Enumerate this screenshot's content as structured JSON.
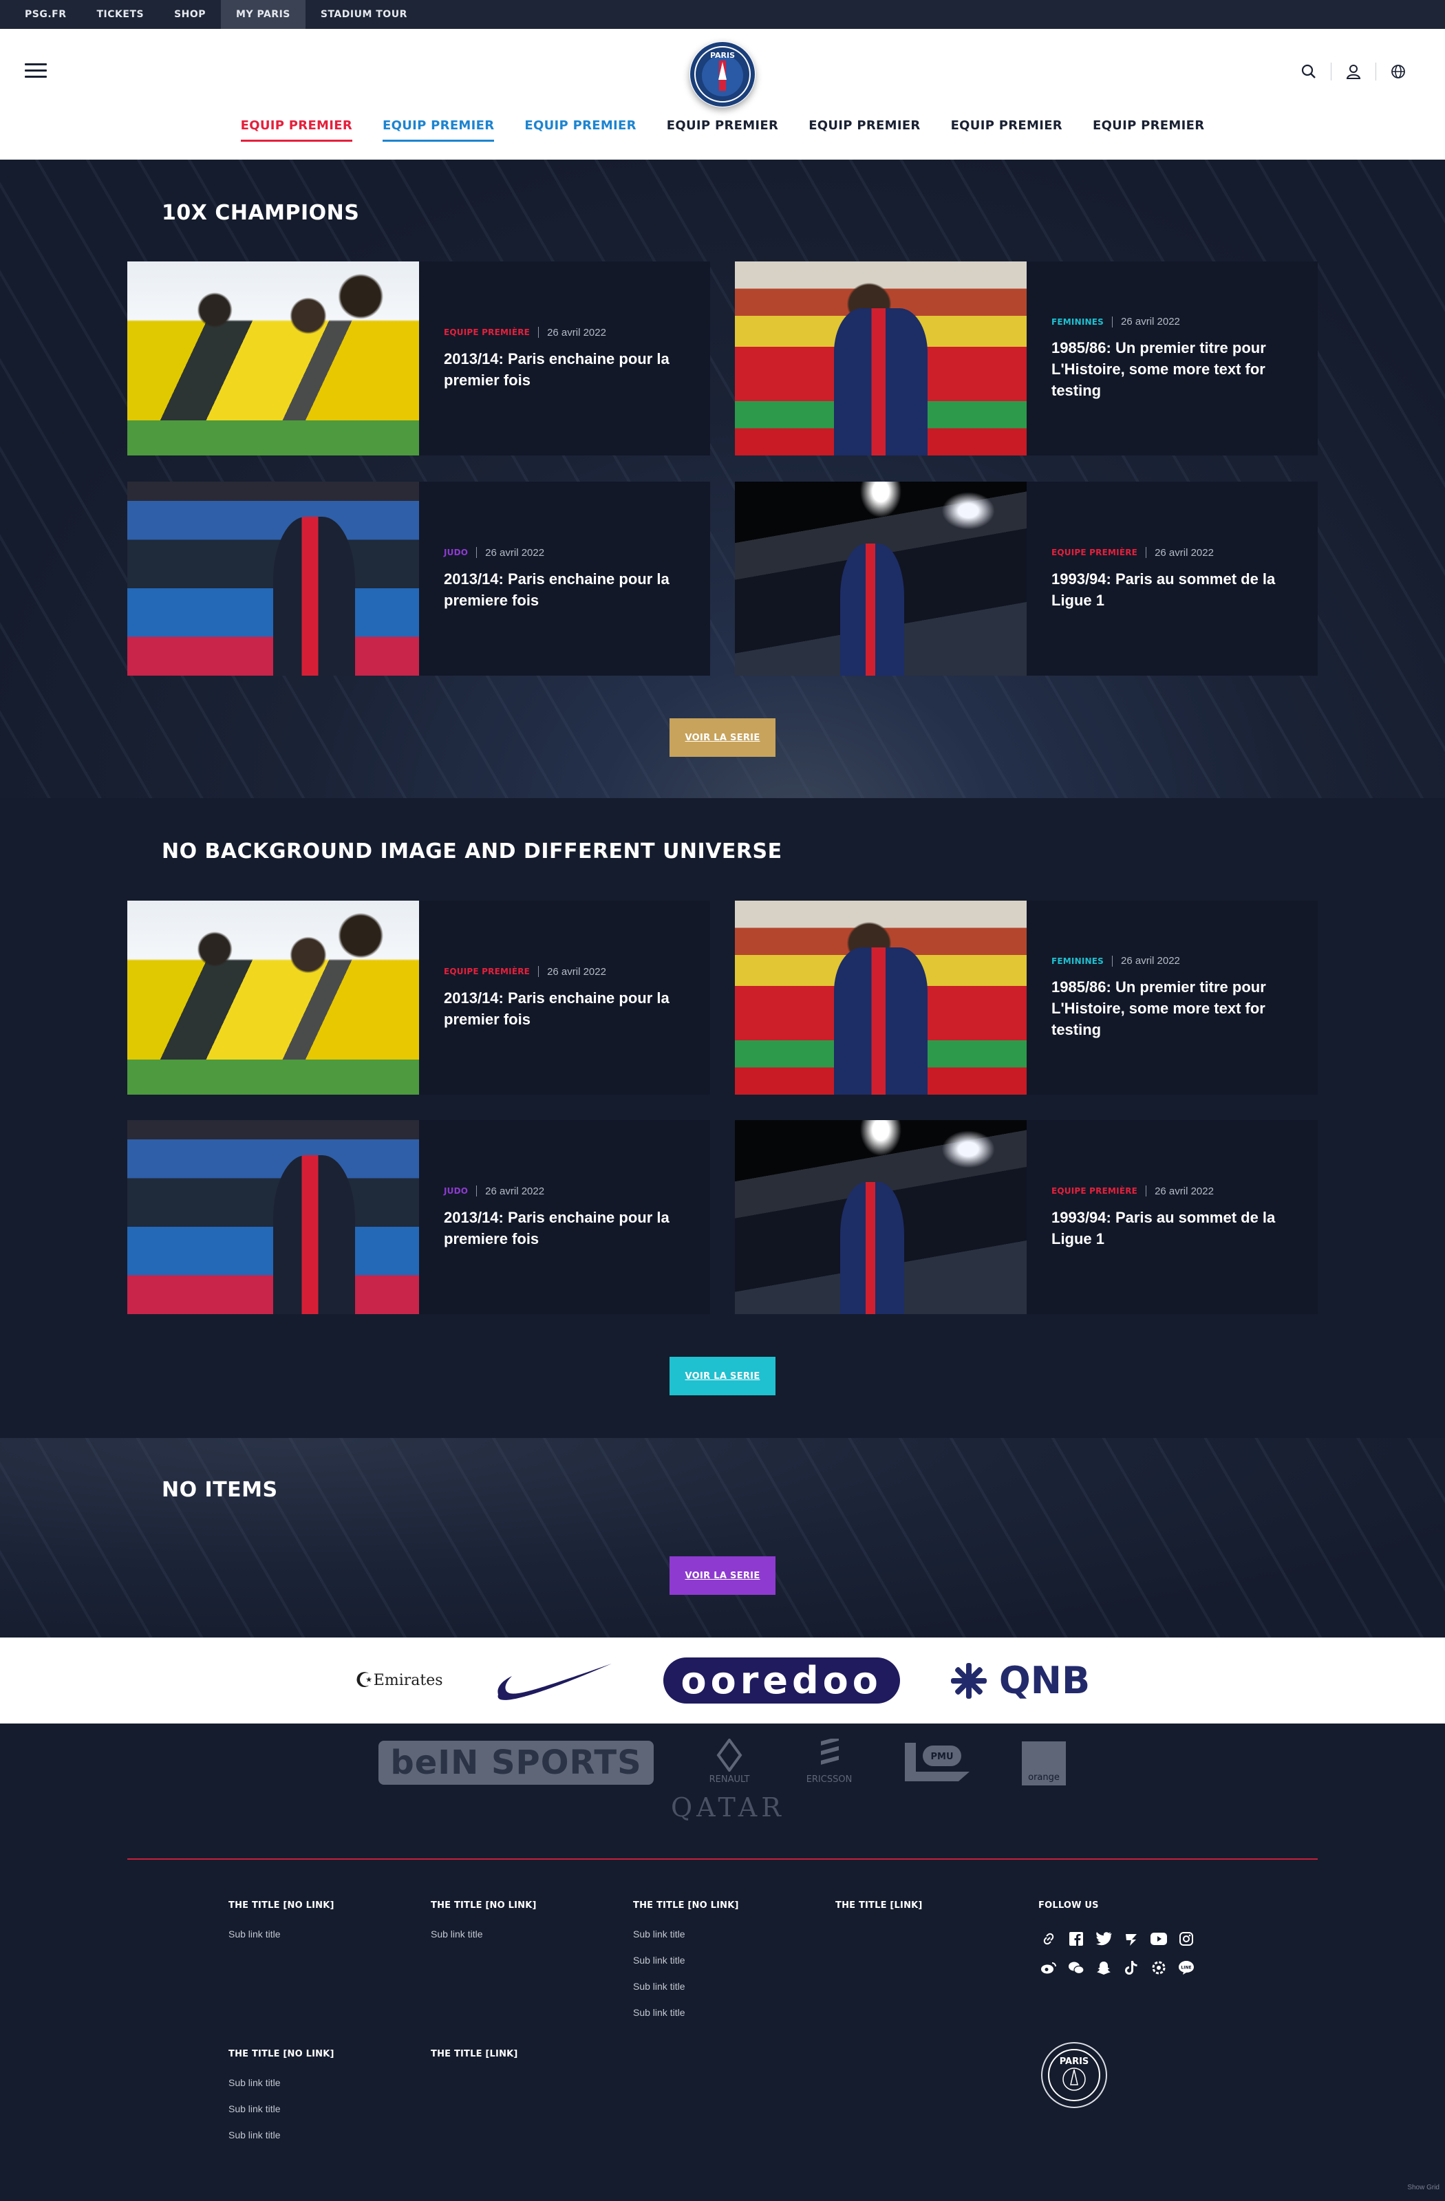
{
  "topbar": {
    "items": [
      "PSG.FR",
      "TICKETS",
      "SHOP",
      "MY PARIS",
      "STADIUM TOUR"
    ],
    "active_index": 3
  },
  "header": {
    "logo_text": "PARIS",
    "nav": [
      "EQUIP PREMIER",
      "EQUIP PREMIER",
      "EQUIP PREMIER",
      "EQUIP PREMIER",
      "EQUIP PREMIER",
      "EQUIP PREMIER",
      "EQUIP PREMIER"
    ],
    "icons": [
      "search-icon",
      "user-icon",
      "globe-icon"
    ]
  },
  "colors": {
    "red": "#e4203c",
    "blue": "#1d84d0",
    "gold": "#c8a35b",
    "cyan": "#1fc0d0",
    "purple": "#8e3ad0",
    "navy": "#151c2d"
  },
  "sections": [
    {
      "title": "10X CHAMPIONS",
      "cta": "VOIR LA SERIE",
      "cards": [
        {
          "category": "EQUIPE PREMIÈRE",
          "category_color": "#e4203c",
          "date": "26 avril 2022",
          "title": "2013/14: Paris enchaine pour la premier fois"
        },
        {
          "category": "FEMININES",
          "category_color": "#1fc0d0",
          "date": "26 avril 2022",
          "title": "1985/86: Un premier titre pour L'Histoire, some more text for testing"
        },
        {
          "category": "JUDO",
          "category_color": "#8e3ad0",
          "date": "26 avril 2022",
          "title": "2013/14: Paris enchaine pour la premiere fois"
        },
        {
          "category": "EQUIPE PREMIÈRE",
          "category_color": "#e4203c",
          "date": "26 avril 2022",
          "title": "1993/94: Paris au sommet de la Ligue 1"
        }
      ]
    },
    {
      "title": "NO BACKGROUND IMAGE AND DIFFERENT UNIVERSE",
      "cta": "VOIR LA SERIE",
      "cards": [
        {
          "category": "EQUIPE PREMIÈRE",
          "category_color": "#e4203c",
          "date": "26 avril 2022",
          "title": "2013/14: Paris enchaine pour la premier fois"
        },
        {
          "category": "FEMININES",
          "category_color": "#1fc0d0",
          "date": "26 avril 2022",
          "title": "1985/86: Un premier titre pour L'Histoire, some more text for testing"
        },
        {
          "category": "JUDO",
          "category_color": "#8e3ad0",
          "date": "26 avril 2022",
          "title": "2013/14: Paris enchaine pour la premiere fois"
        },
        {
          "category": "EQUIPE PREMIÈRE",
          "category_color": "#e4203c",
          "date": "26 avril 2022",
          "title": "1993/94: Paris au sommet de la Ligue 1"
        }
      ]
    },
    {
      "title": "NO ITEMS",
      "cta": "VOIR LA SERIE"
    }
  ],
  "sponsors": {
    "main": [
      "Emirates",
      "ooredoo",
      "QNB"
    ],
    "secondary": [
      "beIN SPORTS",
      "RENAULT",
      "ERICSSON",
      "PMU",
      "orange",
      "QATAR"
    ]
  },
  "footer": {
    "columns": [
      {
        "title": "THE TITLE [NO LINK]",
        "links": [
          "Sub link title"
        ]
      },
      {
        "title": "THE TITLE [NO LINK]",
        "links": [
          "Sub link title"
        ]
      },
      {
        "title": "THE TITLE [NO LINK]",
        "links": [
          "Sub link title",
          "Sub link title",
          "Sub link title",
          "Sub link title"
        ]
      },
      {
        "title": "THE TITLE [LINK]",
        "links": []
      },
      {
        "title": "THE TITLE [NO LINK]",
        "links": [
          "Sub link title",
          "Sub link title",
          "Sub link title"
        ]
      },
      {
        "title": "THE TITLE [LINK]",
        "links": []
      }
    ],
    "follow_title": "FOLLOW US",
    "social_row1": [
      "link-icon",
      "facebook-icon",
      "twitter-icon",
      "tiktok-alt-icon",
      "youtube-icon",
      "instagram-icon"
    ],
    "social_row2": [
      "weibo-icon",
      "wechat-icon",
      "snapchat-icon",
      "tiktok-icon",
      "settings-icon",
      "line-icon"
    ],
    "logo_text": "PARIS",
    "grid_toggle": "Show Grid"
  }
}
